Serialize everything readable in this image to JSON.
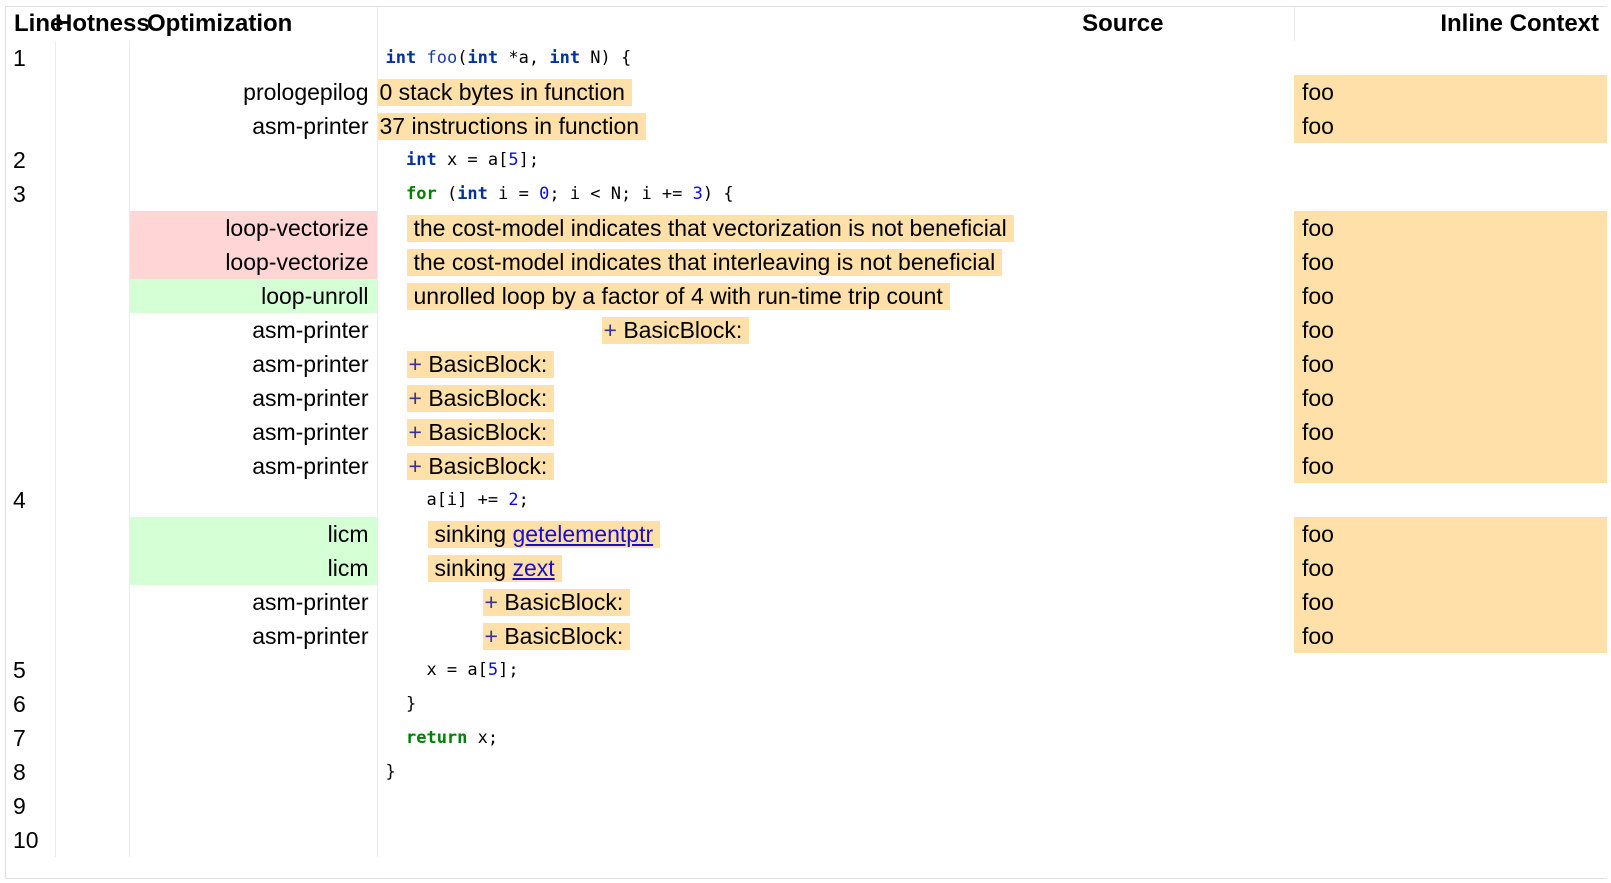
{
  "headers": {
    "line": "Line",
    "hotness": "Hotness",
    "optimization": "Optimization",
    "source": "Source",
    "inline_context": "Inline Context"
  },
  "source": {
    "l1": {
      "num": "1",
      "ty1": "int",
      "fn": "foo",
      "p1": "(",
      "ty2": "int",
      "p2": " *a, ",
      "ty3": "int",
      "p3": " N) {"
    },
    "l2": {
      "num": "2",
      "ty": "int",
      "p1": " x = a[",
      "n": "5",
      "p2": "];"
    },
    "l3": {
      "num": "3",
      "kw": "for",
      "p1": " (",
      "ty": "int",
      "p2": " i = ",
      "n1": "0",
      "p3": "; i < N; i += ",
      "n2": "3",
      "p4": ") {"
    },
    "l4": {
      "num": "4",
      "p1": "a[i] += ",
      "n": "2",
      "p2": ";"
    },
    "l5": {
      "num": "5",
      "p1": "x = a[",
      "n": "5",
      "p2": "];"
    },
    "l6": {
      "num": "6",
      "p1": "}"
    },
    "l7": {
      "num": "7",
      "kw": "return",
      "p1": " x;"
    },
    "l8": {
      "num": "8",
      "p1": "}"
    },
    "l9": {
      "num": "9"
    },
    "l10": {
      "num": "10"
    }
  },
  "remarks": [
    {
      "pass": "prologepilog",
      "text": "0 stack bytes in function",
      "context": "foo"
    },
    {
      "pass": "asm-printer",
      "text": "37 instructions in function",
      "context": "foo"
    },
    {
      "pass": "loop-vectorize",
      "text": "the cost-model indicates that vectorization is not beneficial",
      "context": "foo"
    },
    {
      "pass": "loop-vectorize",
      "text": "the cost-model indicates that interleaving is not beneficial",
      "context": "foo"
    },
    {
      "pass": "loop-unroll",
      "text": "unrolled loop by a factor of 4 with run-time trip count",
      "context": "foo"
    },
    {
      "pass": "asm-printer",
      "plus": "+",
      "text": "BasicBlock:",
      "context": "foo"
    },
    {
      "pass": "asm-printer",
      "plus": "+",
      "text": "BasicBlock:",
      "context": "foo"
    },
    {
      "pass": "asm-printer",
      "plus": "+",
      "text": "BasicBlock:",
      "context": "foo"
    },
    {
      "pass": "asm-printer",
      "plus": "+",
      "text": "BasicBlock:",
      "context": "foo"
    },
    {
      "pass": "asm-printer",
      "plus": "+",
      "text": "BasicBlock:",
      "context": "foo"
    },
    {
      "pass": "licm",
      "text": "sinking ",
      "link": "getelementptr",
      "context": "foo"
    },
    {
      "pass": "licm",
      "text": "sinking ",
      "link": "zext",
      "context": "foo"
    },
    {
      "pass": "asm-printer",
      "plus": "+",
      "text": "BasicBlock:",
      "context": "foo"
    },
    {
      "pass": "asm-printer",
      "plus": "+",
      "text": "BasicBlock:",
      "context": "foo"
    }
  ],
  "colors": {
    "remark_bg": "#ffe0a8",
    "missed_bg": "#ffd5d5",
    "passed_bg": "#d5ffd5"
  }
}
